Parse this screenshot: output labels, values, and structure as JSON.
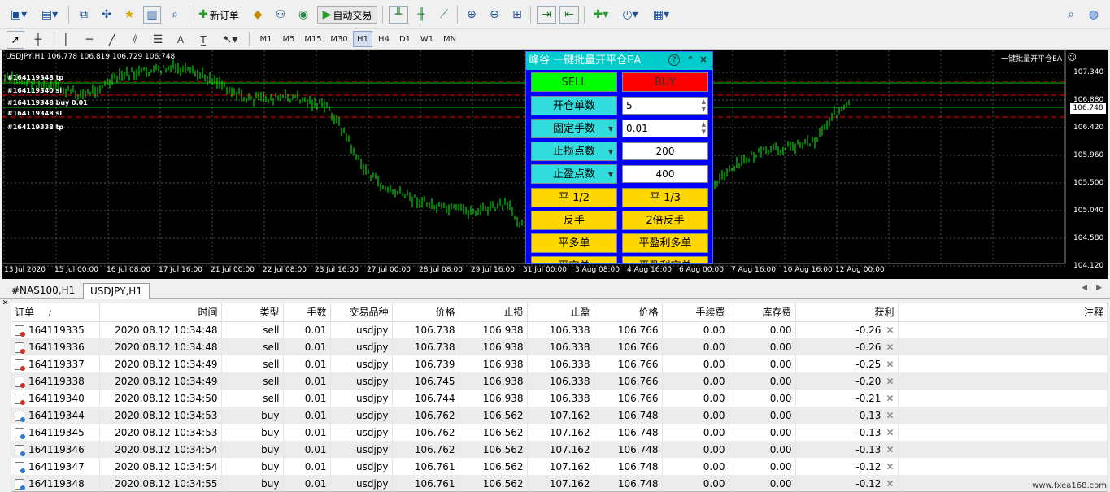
{
  "toolbar": {
    "new_order_label": "新订单",
    "auto_trading_label": "自动交易",
    "timeframes": [
      "M1",
      "M5",
      "M15",
      "M30",
      "H1",
      "H4",
      "D1",
      "W1",
      "MN"
    ],
    "active_timeframe": "H1"
  },
  "chart": {
    "symbol_line": "USDJPY,H1  106.778 106.819 106.729 106.748",
    "ea_label": "一键批量开平仓EA",
    "current_price": "106.748",
    "order_labels": [
      "#164119348 tp",
      "#164119340 sl",
      "#164119348 buy 0.01",
      "#164119348 sl",
      "#164119338 tp"
    ],
    "y_ticks": [
      "107.340",
      "106.880",
      "106.420",
      "105.960",
      "105.500",
      "105.040",
      "104.580",
      "104.120"
    ],
    "x_ticks": [
      "13 Jul 2020",
      "15 Jul 00:00",
      "16 Jul 08:00",
      "17 Jul 16:00",
      "21 Jul 00:00",
      "22 Jul 08:00",
      "23 Jul 16:00",
      "27 Jul 00:00",
      "28 Jul 08:00",
      "29 Jul 16:00",
      "31 Jul 00:00",
      "3 Aug 08:00",
      "4 Aug 16:00",
      "6 Aug 00:00",
      "7 Aug 16:00",
      "10 Aug 16:00",
      "12 Aug 00:00"
    ],
    "colors": {
      "candle": "#00ff00",
      "bg": "#000000",
      "red_line": "#ff0000",
      "green_line": "#00c000"
    }
  },
  "ea_panel": {
    "title": "峰谷 一键批量开平仓EA",
    "sell": "SELL",
    "buy": "BUY",
    "rows": [
      {
        "label": "开仓单数",
        "value": "5"
      },
      {
        "label": "固定手数",
        "value": "0.01"
      },
      {
        "label": "止损点数",
        "value": "200"
      },
      {
        "label": "止盈点数",
        "value": "400"
      }
    ],
    "actions": [
      [
        "平 1/2",
        "平 1/3"
      ],
      [
        "反手",
        "2倍反手"
      ],
      [
        "平多单",
        "平盈利多单"
      ],
      [
        "平空单",
        "平盈利空单"
      ]
    ]
  },
  "tabs": [
    "#NAS100,H1",
    "USDJPY,H1"
  ],
  "active_tab": "USDJPY,H1",
  "table": {
    "headers": [
      "订单",
      "/",
      "时间",
      "类型",
      "手数",
      "交易品种",
      "价格",
      "止损",
      "止盈",
      "价格",
      "手续费",
      "库存费",
      "获利",
      "注释"
    ],
    "rows": [
      [
        "164119335",
        "2020.08.12 10:34:48",
        "sell",
        "0.01",
        "usdjpy",
        "106.738",
        "106.938",
        "106.338",
        "106.766",
        "0.00",
        "0.00",
        "-0.26"
      ],
      [
        "164119336",
        "2020.08.12 10:34:48",
        "sell",
        "0.01",
        "usdjpy",
        "106.738",
        "106.938",
        "106.338",
        "106.766",
        "0.00",
        "0.00",
        "-0.26"
      ],
      [
        "164119337",
        "2020.08.12 10:34:49",
        "sell",
        "0.01",
        "usdjpy",
        "106.739",
        "106.938",
        "106.338",
        "106.766",
        "0.00",
        "0.00",
        "-0.25"
      ],
      [
        "164119338",
        "2020.08.12 10:34:49",
        "sell",
        "0.01",
        "usdjpy",
        "106.745",
        "106.938",
        "106.338",
        "106.766",
        "0.00",
        "0.00",
        "-0.20"
      ],
      [
        "164119340",
        "2020.08.12 10:34:50",
        "sell",
        "0.01",
        "usdjpy",
        "106.744",
        "106.938",
        "106.338",
        "106.766",
        "0.00",
        "0.00",
        "-0.21"
      ],
      [
        "164119344",
        "2020.08.12 10:34:53",
        "buy",
        "0.01",
        "usdjpy",
        "106.762",
        "106.562",
        "107.162",
        "106.748",
        "0.00",
        "0.00",
        "-0.13"
      ],
      [
        "164119345",
        "2020.08.12 10:34:53",
        "buy",
        "0.01",
        "usdjpy",
        "106.762",
        "106.562",
        "107.162",
        "106.748",
        "0.00",
        "0.00",
        "-0.13"
      ],
      [
        "164119346",
        "2020.08.12 10:34:54",
        "buy",
        "0.01",
        "usdjpy",
        "106.762",
        "106.562",
        "107.162",
        "106.748",
        "0.00",
        "0.00",
        "-0.13"
      ],
      [
        "164119347",
        "2020.08.12 10:34:54",
        "buy",
        "0.01",
        "usdjpy",
        "106.761",
        "106.562",
        "107.162",
        "106.748",
        "0.00",
        "0.00",
        "-0.12"
      ],
      [
        "164119348",
        "2020.08.12 10:34:55",
        "buy",
        "0.01",
        "usdjpy",
        "106.761",
        "106.562",
        "107.162",
        "106.748",
        "0.00",
        "0.00",
        "-0.12"
      ]
    ]
  },
  "watermark": "www.fxea168.com"
}
